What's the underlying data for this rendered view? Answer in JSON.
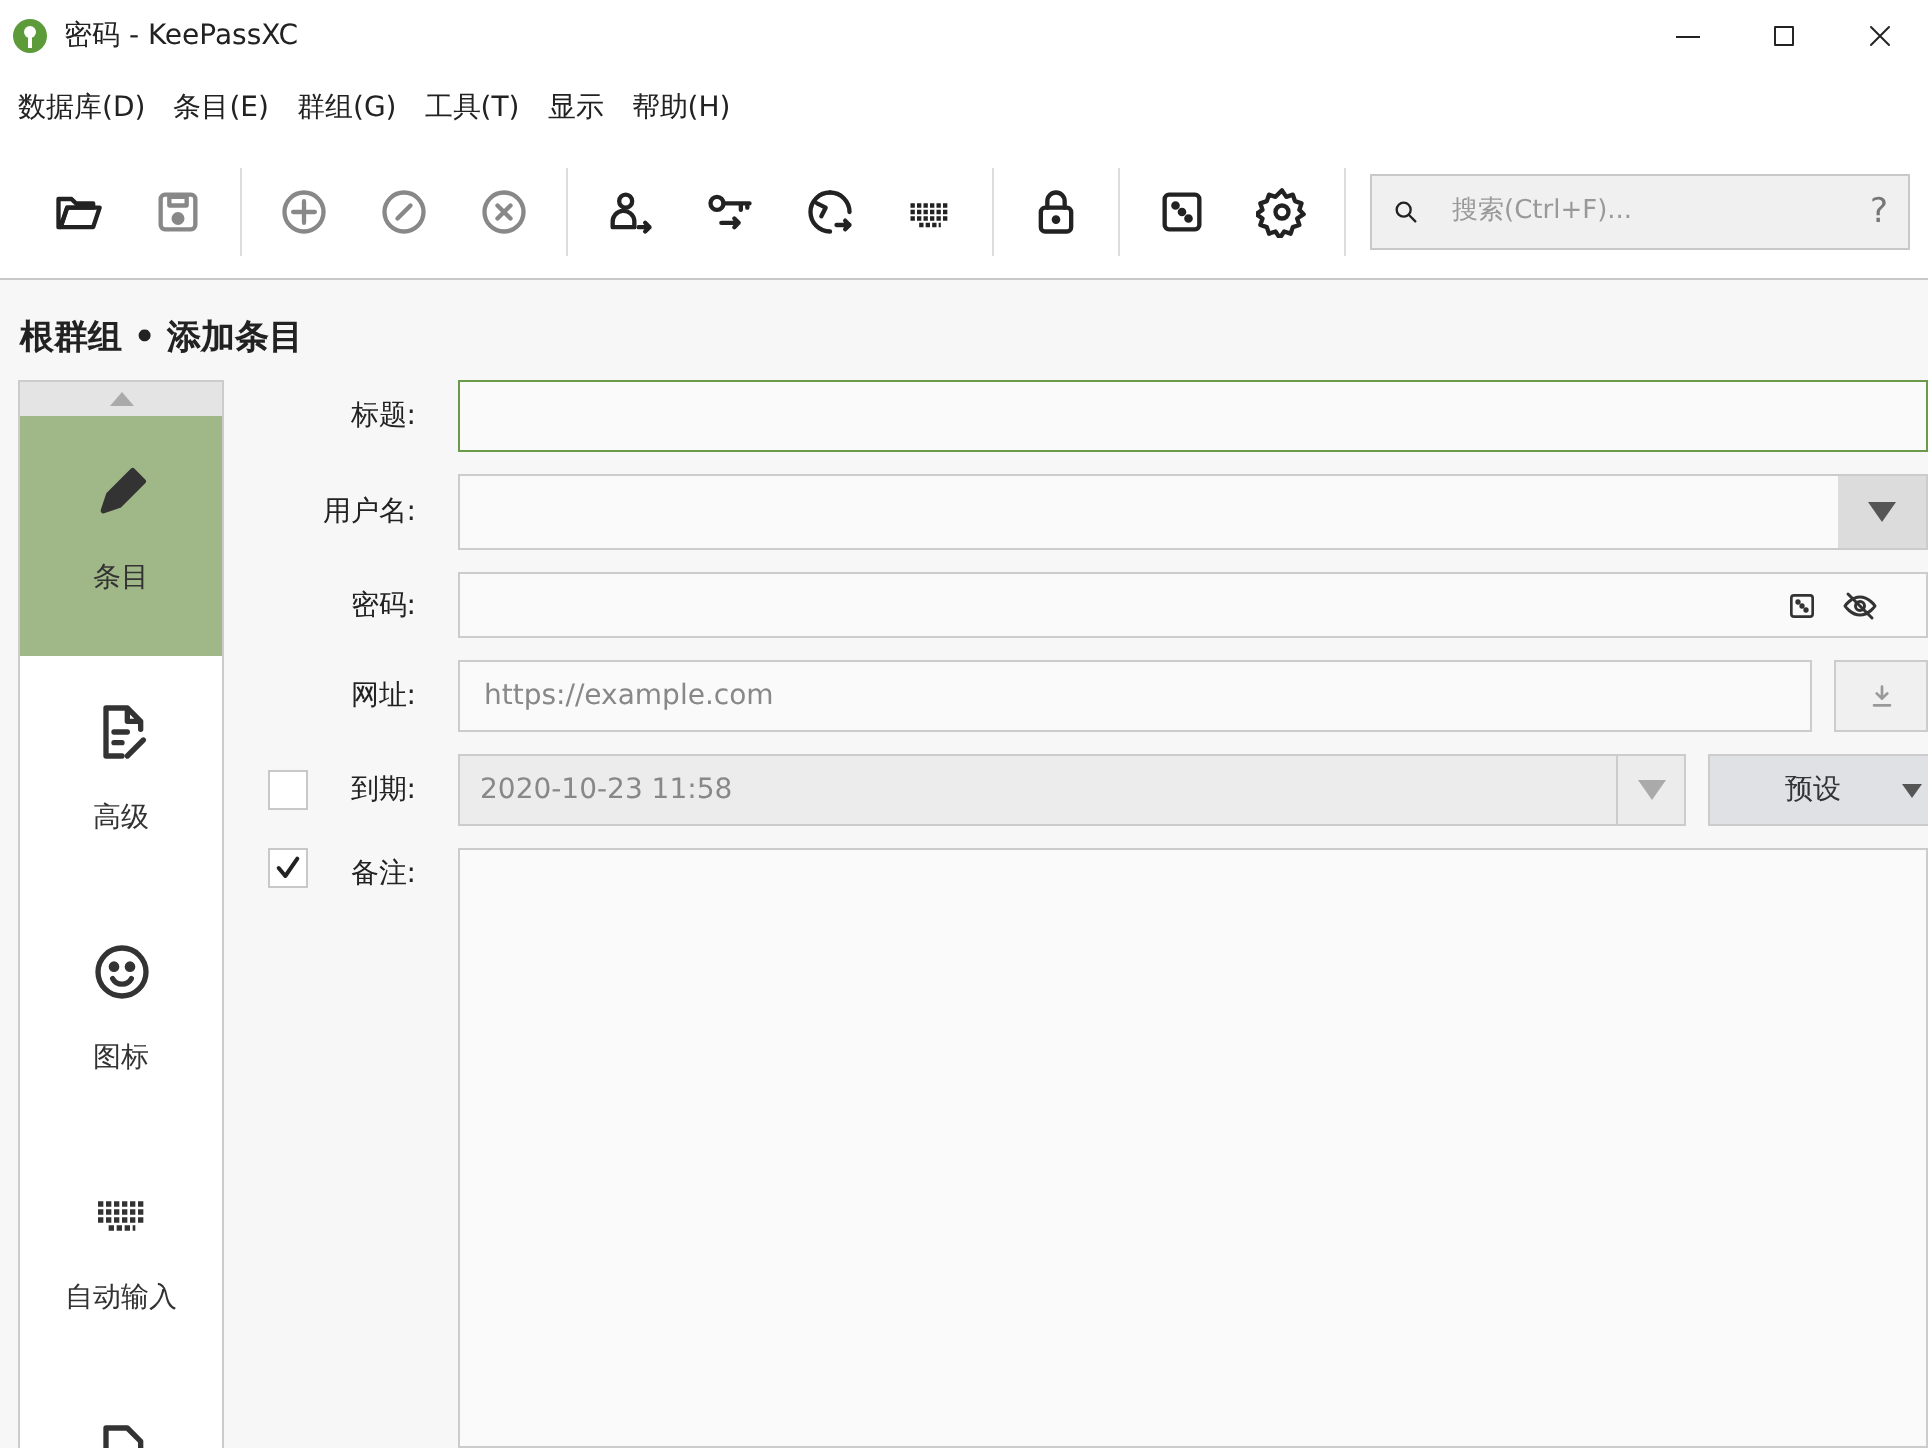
{
  "window": {
    "title": "密码 - KeePassXC"
  },
  "menu": [
    {
      "label": "数据库(D)"
    },
    {
      "label": "条目(E)"
    },
    {
      "label": "群组(G)"
    },
    {
      "label": "工具(T)"
    },
    {
      "label": "显示"
    },
    {
      "label": "帮助(H)"
    }
  ],
  "toolbar": [
    {
      "kind": "open",
      "disabled": false
    },
    {
      "kind": "save",
      "disabled": true
    },
    {
      "kind": "separator"
    },
    {
      "kind": "add",
      "disabled": true
    },
    {
      "kind": "edit",
      "disabled": true
    },
    {
      "kind": "delete",
      "disabled": true
    },
    {
      "kind": "separator"
    },
    {
      "kind": "user",
      "disabled": false
    },
    {
      "kind": "key",
      "disabled": false
    },
    {
      "kind": "globe",
      "disabled": false
    },
    {
      "kind": "keyboard",
      "disabled": false
    },
    {
      "kind": "separator"
    },
    {
      "kind": "lock",
      "disabled": false
    },
    {
      "kind": "separator"
    },
    {
      "kind": "dice",
      "disabled": false
    },
    {
      "kind": "gear",
      "disabled": false
    },
    {
      "kind": "separator"
    }
  ],
  "search": {
    "placeholder": "搜索(Ctrl+F)...",
    "help": "?"
  },
  "breadcrumb": "根群组 • 添加条目",
  "sidebar": {
    "items": [
      {
        "kind": "pencil",
        "label": "条目",
        "selected": true
      },
      {
        "kind": "document",
        "label": "高级",
        "selected": false
      },
      {
        "kind": "smiley",
        "label": "图标",
        "selected": false
      },
      {
        "kind": "keyboard",
        "label": "自动输入",
        "selected": false
      },
      {
        "kind": "file",
        "selected": false
      }
    ]
  },
  "form": {
    "title": {
      "label": "标题:",
      "focused": true
    },
    "username": {
      "label": "用户名:"
    },
    "password": {
      "label": "密码:"
    },
    "url": {
      "label": "网址:",
      "placeholder": "https://example.com"
    },
    "expiry": {
      "label": "到期:",
      "checked": false,
      "value": "2020-10-23 11:58",
      "preset": "预设"
    },
    "notes": {
      "label": "备注:",
      "checked": true
    }
  }
}
